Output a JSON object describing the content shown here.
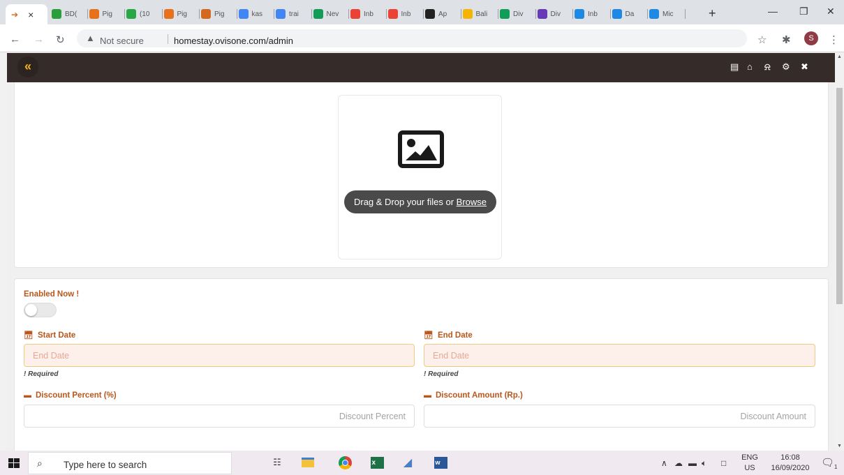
{
  "browser": {
    "active_tab_close": "×",
    "tabs": [
      {
        "label": "BD(",
        "color": "#2a9d3c",
        "icon": "google-drive-icon"
      },
      {
        "label": "Pig",
        "color": "#e8721c",
        "icon": "pig-icon"
      },
      {
        "label": "(10",
        "color": "#27a845",
        "icon": "whatsapp-icon"
      },
      {
        "label": "Pig",
        "color": "#e8721c",
        "icon": "pig-icon"
      },
      {
        "label": "Pig",
        "color": "#d2691e",
        "icon": "bird-icon"
      },
      {
        "label": "kas",
        "color": "#4285f4",
        "icon": "google-icon"
      },
      {
        "label": "trai",
        "color": "#4285f4",
        "icon": "google-icon"
      },
      {
        "label": "Nev",
        "color": "#0f9d58",
        "icon": "sheets-icon"
      },
      {
        "label": "Inb",
        "color": "#ea4335",
        "icon": "gmail-icon"
      },
      {
        "label": "Inb",
        "color": "#ea4335",
        "icon": "gmail-icon"
      },
      {
        "label": "Ap",
        "color": "#222222",
        "icon": "medium-icon"
      },
      {
        "label": "Bali",
        "color": "#f4b400",
        "icon": "google-drive-icon"
      },
      {
        "label": "Div",
        "color": "#0f9d58",
        "icon": "sheets-icon"
      },
      {
        "label": "Div",
        "color": "#673ab7",
        "icon": "forms-icon"
      },
      {
        "label": "Inb",
        "color": "#1e88e5",
        "icon": "mail-icon"
      },
      {
        "label": "Da",
        "color": "#1e88e5",
        "icon": "circle-app-icon"
      },
      {
        "label": "Mic",
        "color": "#1e88e5",
        "icon": "circle-app-icon"
      }
    ],
    "new_tab": "+",
    "not_secure": "Not secure",
    "url": "homestay.ovisone.com/admin",
    "profile_initial": "S"
  },
  "admin": {
    "collapse_icon": "«"
  },
  "upload": {
    "drop_text": "Drag & Drop your files or ",
    "browse_text": "Browse"
  },
  "form": {
    "enabled_label": "Enabled Now !",
    "enabled_value": false,
    "start_date_label": "Start Date",
    "start_date_placeholder": "End Date",
    "start_date_required": "! Required",
    "end_date_label": "End Date",
    "end_date_placeholder": "End Date",
    "end_date_required": "! Required",
    "discount_percent_label": "Discount Percent (%)",
    "discount_percent_placeholder": "Discount Percent",
    "discount_amount_label": "Discount Amount (Rp.)",
    "discount_amount_placeholder": "Discount Amount"
  },
  "taskbar": {
    "search_placeholder": "Type here to search",
    "lang_top": "ENG",
    "lang_bottom": "US",
    "time": "16:08",
    "date": "16/09/2020",
    "notification_count": "1"
  }
}
